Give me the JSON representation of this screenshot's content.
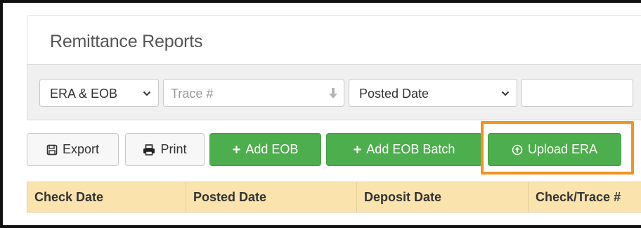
{
  "panel": {
    "title": "Remittance Reports"
  },
  "filters": {
    "type_select": {
      "selected": "ERA & EOB"
    },
    "trace_input": {
      "placeholder": "Trace #",
      "value": ""
    },
    "date_select": {
      "selected": "Posted Date"
    },
    "date_input": {
      "value": ""
    }
  },
  "toolbar": {
    "export_label": "Export",
    "print_label": "Print",
    "add_eob_label": "Add EOB",
    "add_eob_batch_label": "Add EOB Batch",
    "upload_era_label": "Upload ERA"
  },
  "table": {
    "columns": [
      "Check Date",
      "Posted Date",
      "Deposit Date",
      "Check/Trace #"
    ]
  },
  "colors": {
    "success": "#4cae4c",
    "highlight": "#f39221",
    "table_header": "#fbe3ae"
  }
}
